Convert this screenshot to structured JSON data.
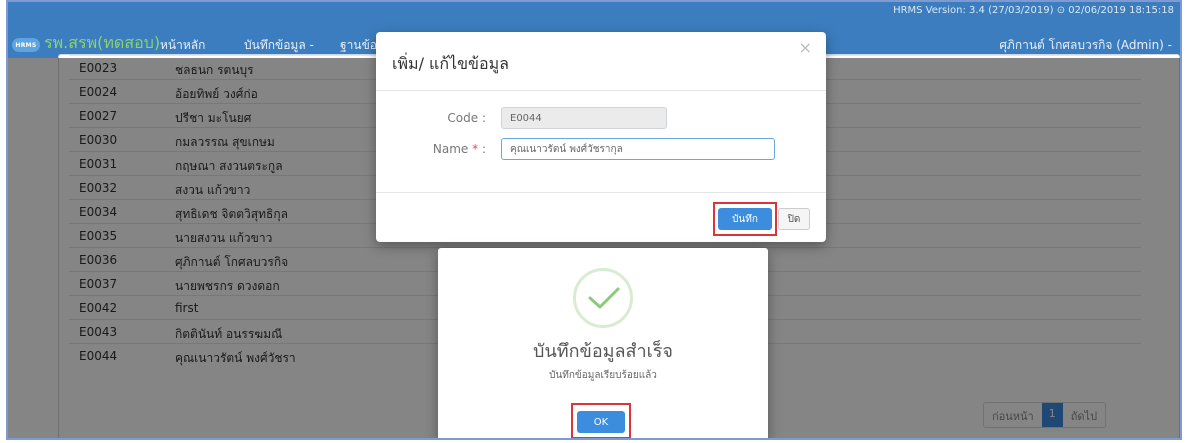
{
  "header": {
    "version": "HRMS Version: 3.4 (27/03/2019) ⊙ 02/06/2019 18:15:18",
    "logo": "HRMS",
    "brand": "รพ.สรพ(ทดสอบ)",
    "nav": [
      {
        "label": "หน้าหลัก"
      },
      {
        "label": "บันทึกข้อมูล -"
      },
      {
        "label": "ฐานข้อ"
      }
    ],
    "user": "ศุภิกานต์ โกศลบวรกิจ (Admin) -"
  },
  "table": {
    "rows": [
      {
        "code": "E0023",
        "name": "ชลธนก รตนบุร"
      },
      {
        "code": "E0024",
        "name": "อ้อยทิพย์ วงศ์ก่อ"
      },
      {
        "code": "E0027",
        "name": "ปรีชา มะโนยศ"
      },
      {
        "code": "E0030",
        "name": "กมลวรรณ สุขเกษม"
      },
      {
        "code": "E0031",
        "name": "กฤษณา สงวนตระกูล"
      },
      {
        "code": "E0032",
        "name": "สงวน แก้วขาว"
      },
      {
        "code": "E0034",
        "name": "สุทธิเดช จิตตวิสุทธิกุล"
      },
      {
        "code": "E0035",
        "name": "นายสงวน แก้วขาว"
      },
      {
        "code": "E0036",
        "name": "ศุภิกานต์ โกศลบวรกิจ"
      },
      {
        "code": "E0037",
        "name": "นายพชรกร ดวงดอก"
      },
      {
        "code": "E0042",
        "name": "first"
      },
      {
        "code": "E0043",
        "name": "กิตตินันท์ อนรรฆมณี"
      },
      {
        "code": "E0044",
        "name": "คุณเนาวรัตน์ พงศ์วัชรา"
      }
    ]
  },
  "pagination": {
    "prev": "ก่อนหน้า",
    "current": "1",
    "next": "ถัดไป"
  },
  "modal": {
    "title": "เพิ่ม/ แก้ไขข้อมูล",
    "close_symbol": "×",
    "code_label": "Code :",
    "code_value": "E0044",
    "name_label": "Name",
    "required_mark": "*",
    "name_colon": ":",
    "name_value": "คุณเนาวรัตน์ พงศ์วัชรากุล",
    "save_label": "บันทึก",
    "close_label": "ปิด"
  },
  "alert": {
    "icon": "checkmark-icon",
    "title": "บันทึกข้อมูลสำเร็จ",
    "text": "บันทึกข้อมูลเรียบร้อยแล้ว",
    "ok_label": "OK"
  },
  "colors": {
    "navbar": "#3c7dbf",
    "brand": "#8ad36a",
    "primary_button": "#3c8dde",
    "highlight": "#d9353a",
    "success": "#8cc97a"
  }
}
